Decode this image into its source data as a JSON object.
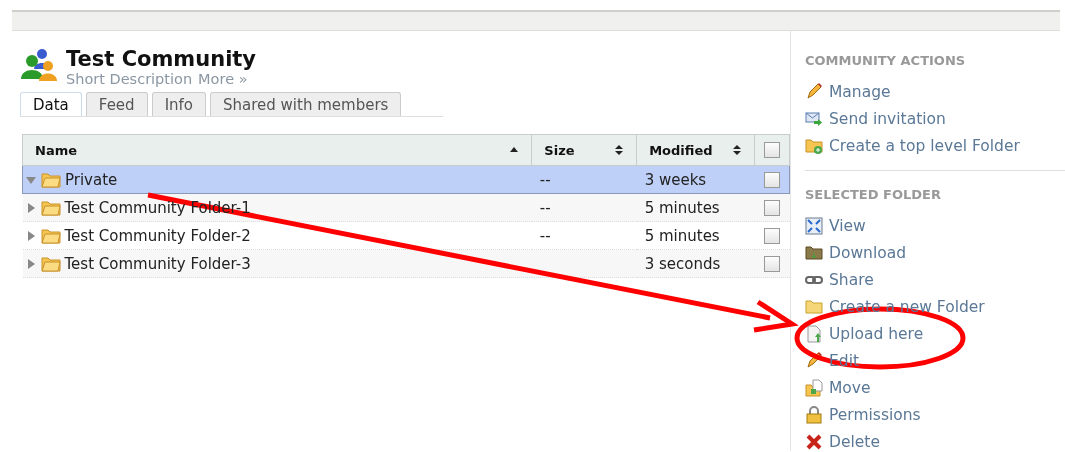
{
  "community": {
    "title": "Test Community",
    "description": "Short Description",
    "more_link": "More »"
  },
  "tabs": [
    {
      "label": "Data",
      "selected": true
    },
    {
      "label": "Feed",
      "selected": false
    },
    {
      "label": "Info",
      "selected": false
    },
    {
      "label": "Shared with members",
      "selected": false
    }
  ],
  "table": {
    "columns": [
      {
        "label": "Name"
      },
      {
        "label": "Size"
      },
      {
        "label": "Modified"
      }
    ],
    "select_all_checked": false,
    "rows": [
      {
        "name": "Private",
        "size": "--",
        "modified": "3 weeks",
        "expanded": true,
        "selected": true,
        "checked": false
      },
      {
        "name": "Test Community Folder-1",
        "size": "--",
        "modified": "5 minutes",
        "expanded": false,
        "selected": false,
        "checked": false
      },
      {
        "name": "Test Community Folder-2",
        "size": "--",
        "modified": "5 minutes",
        "expanded": false,
        "selected": false,
        "checked": false
      },
      {
        "name": "Test Community Folder-3",
        "size": "",
        "modified": "3 seconds",
        "expanded": false,
        "selected": false,
        "checked": false
      }
    ]
  },
  "sidebar": {
    "sections": [
      {
        "title": "COMMUNITY ACTIONS",
        "items": [
          {
            "label": "Manage"
          },
          {
            "label": "Send invitation"
          },
          {
            "label": "Create a top level Folder"
          }
        ]
      },
      {
        "title": "SELECTED FOLDER",
        "items": [
          {
            "label": "View"
          },
          {
            "label": "Download"
          },
          {
            "label": "Share"
          },
          {
            "label": "Create a new Folder"
          },
          {
            "label": "Upload here"
          },
          {
            "label": "Edit"
          },
          {
            "label": "Move"
          },
          {
            "label": "Permissions"
          },
          {
            "label": "Delete"
          }
        ]
      }
    ]
  }
}
